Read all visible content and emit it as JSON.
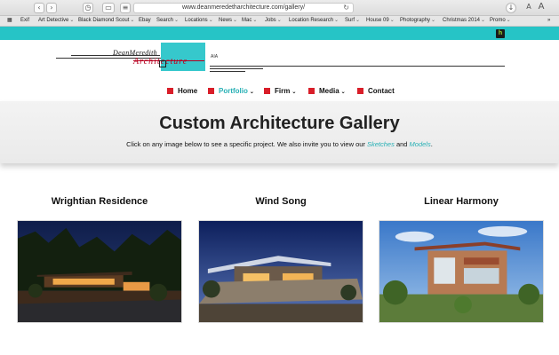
{
  "browser": {
    "url": "www.deanmeredetharchitecture.com/gallery/",
    "toolbar_icons": [
      "back-icon",
      "forward-icon",
      "reader-icon",
      "history-icon",
      "sidebar-icon",
      "menu-icon",
      "reload-icon",
      "download-icon",
      "text-size-icon",
      "reader-view-icon"
    ]
  },
  "bookmarks": [
    {
      "label": "Exif",
      "menu": false
    },
    {
      "label": "Art Detective",
      "menu": true
    },
    {
      "label": "Black Diamond Scout",
      "menu": true
    },
    {
      "label": "Ebay",
      "menu": false
    },
    {
      "label": "Search",
      "menu": true
    },
    {
      "label": "Locations",
      "menu": true
    },
    {
      "label": "News",
      "menu": true
    },
    {
      "label": "Mac",
      "menu": true
    },
    {
      "label": "Jobs",
      "menu": true
    },
    {
      "label": "Location Research",
      "menu": true
    },
    {
      "label": "Surf",
      "menu": true
    },
    {
      "label": "House 09",
      "menu": true
    },
    {
      "label": "Photography",
      "menu": true
    },
    {
      "label": "Christmas 2014",
      "menu": true
    },
    {
      "label": "Promo",
      "menu": true
    }
  ],
  "bookmarks_more": "»",
  "logo": {
    "name": "DeanMeredith",
    "script": "Architecture",
    "suffix": "AIA"
  },
  "nav": [
    {
      "label": "Home",
      "dropdown": false,
      "active": false
    },
    {
      "label": "Portfolio",
      "dropdown": true,
      "active": true
    },
    {
      "label": "Firm",
      "dropdown": true,
      "active": false
    },
    {
      "label": "Media",
      "dropdown": true,
      "active": false
    },
    {
      "label": "Contact",
      "dropdown": false,
      "active": false
    }
  ],
  "hero": {
    "title": "Custom Architecture Gallery",
    "subtitle_prefix": "Click on any image below to see a specific project.  We also invite you to view our ",
    "link_sketches": "Sketches",
    "subtitle_and": " and ",
    "link_models": "Models",
    "subtitle_suffix": "."
  },
  "gallery": [
    {
      "title": "Wrightian Residence"
    },
    {
      "title": "Wind Song"
    },
    {
      "title": "Linear Harmony"
    }
  ],
  "colors": {
    "accent": "#26c4c6",
    "nav_marker": "#d91e29",
    "active_link": "#27b0b5"
  }
}
